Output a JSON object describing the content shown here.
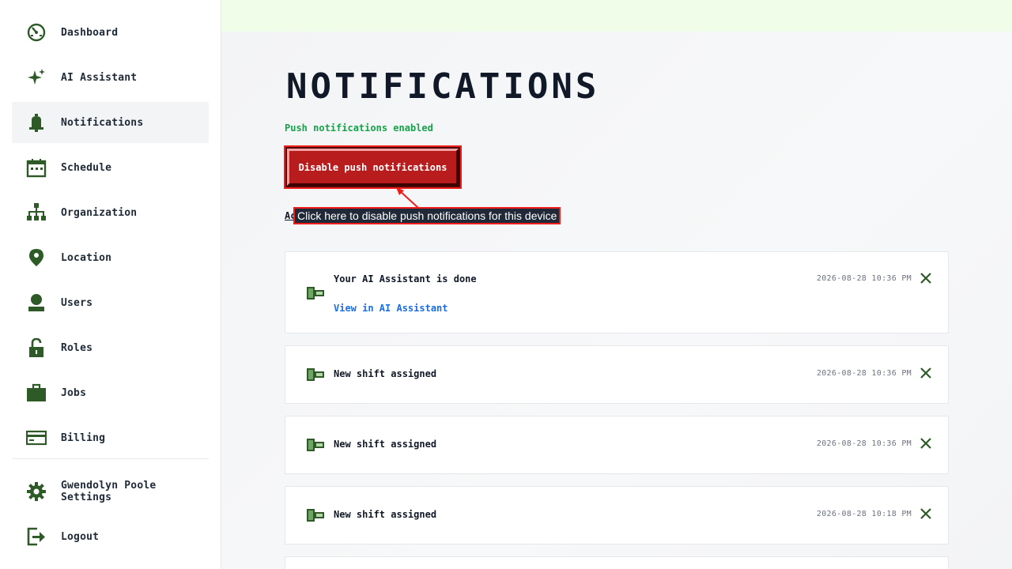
{
  "sidebar": {
    "items": [
      {
        "label": "Dashboard",
        "icon": "dashboard-icon"
      },
      {
        "label": "AI Assistant",
        "icon": "sparkle-icon"
      },
      {
        "label": "Notifications",
        "icon": "bell-icon",
        "active": true
      },
      {
        "label": "Schedule",
        "icon": "calendar-icon"
      },
      {
        "label": "Organization",
        "icon": "org-chart-icon"
      },
      {
        "label": "Location",
        "icon": "location-pin-icon"
      },
      {
        "label": "Users",
        "icon": "user-icon"
      },
      {
        "label": "Roles",
        "icon": "lock-icon"
      },
      {
        "label": "Jobs",
        "icon": "briefcase-icon"
      },
      {
        "label": "Billing",
        "icon": "credit-card-icon"
      }
    ],
    "footer": [
      {
        "label": "Gwendolyn Poole Settings",
        "icon": "gear-icon"
      },
      {
        "label": "Logout",
        "icon": "logout-icon"
      }
    ]
  },
  "main": {
    "title": "NOTIFICATIONS",
    "push_status": "Push notifications enabled",
    "disable_button": "Disable push notifications",
    "partial_link": "Ac",
    "tooltip": "Click here to disable push notifications for this device"
  },
  "notifications": [
    {
      "title": "Your AI Assistant is done",
      "link": "View in AI Assistant",
      "time": "2026-08-28 10:36 PM"
    },
    {
      "title": "New shift assigned",
      "time": "2026-08-28 10:36 PM"
    },
    {
      "title": "New shift assigned",
      "time": "2026-08-28 10:36 PM"
    },
    {
      "title": "New shift assigned",
      "time": "2026-08-28 10:18 PM"
    }
  ],
  "colors": {
    "icon_green": "#2d5a27",
    "status_green": "#16a34a",
    "danger_red": "#b91c1c",
    "link_blue": "#1d6ee0"
  }
}
